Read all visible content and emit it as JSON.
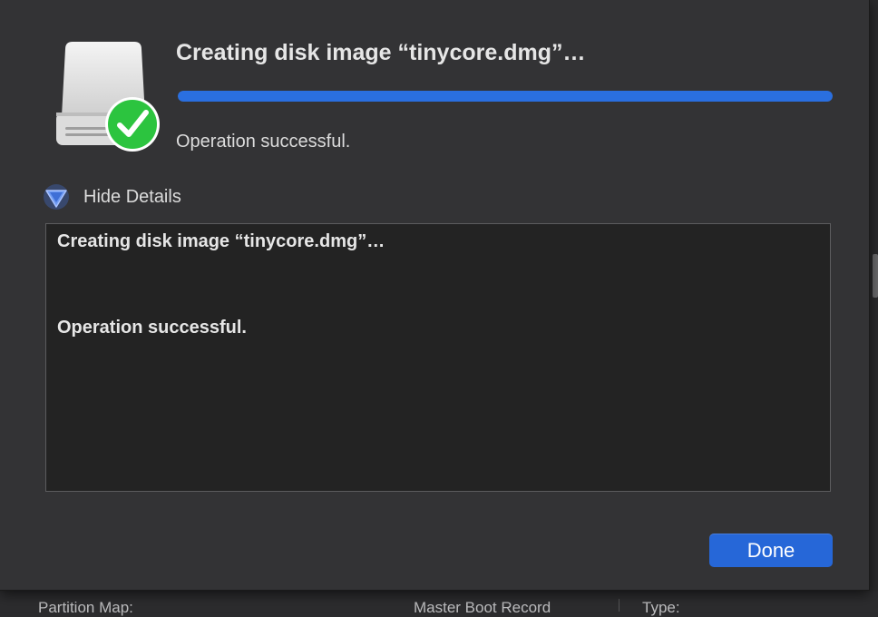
{
  "dialog": {
    "title": "Creating disk image “tinycore.dmg”…",
    "status": "Operation successful.",
    "progress_percent": 100,
    "disclosure_label": "Hide Details",
    "details_lines": [
      "Creating disk image “tinycore.dmg”…",
      "Operation successful."
    ],
    "done_label": "Done",
    "icons": {
      "main": "external-disk-icon",
      "badge": "green-checkmark-icon",
      "disclosure": "disclosure-triangle-down-icon"
    }
  },
  "background": {
    "labels": [
      "Partition Map:",
      "Master Boot Record",
      "Type:"
    ]
  },
  "colors": {
    "accent": "#2667d8",
    "progress": "#2a6fe0",
    "success_badge": "#2cc43f"
  }
}
